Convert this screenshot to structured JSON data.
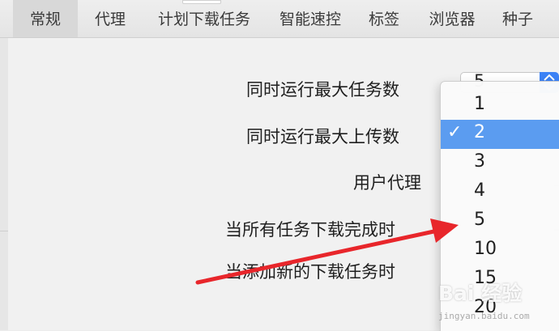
{
  "toolbar": {
    "tabs": [
      {
        "label": "常规",
        "active": true
      },
      {
        "label": "代理"
      },
      {
        "label": "计划下载任务"
      },
      {
        "label": "智能速控"
      },
      {
        "label": "标签"
      },
      {
        "label": "浏览器"
      },
      {
        "label": "种子"
      }
    ]
  },
  "settings": {
    "max_tasks_label": "同时运行最大任务数",
    "max_uploads_label": "同时运行最大上传数",
    "user_agent_label": "用户代理",
    "on_complete_label": "当所有任务下载完成时",
    "on_new_task_label": "当添加新的下载任务时",
    "max_tasks_value": "5"
  },
  "menu": {
    "check_mark": "✓",
    "options": [
      "1",
      "2",
      "3",
      "4",
      "5",
      "10",
      "15",
      "20"
    ],
    "selected": "2"
  },
  "colors": {
    "selection": "#5b9cf0",
    "arrow": "#e8262b"
  },
  "watermark": {
    "logo": "Bai 经验",
    "sub": "jingyan.baidu.com"
  }
}
